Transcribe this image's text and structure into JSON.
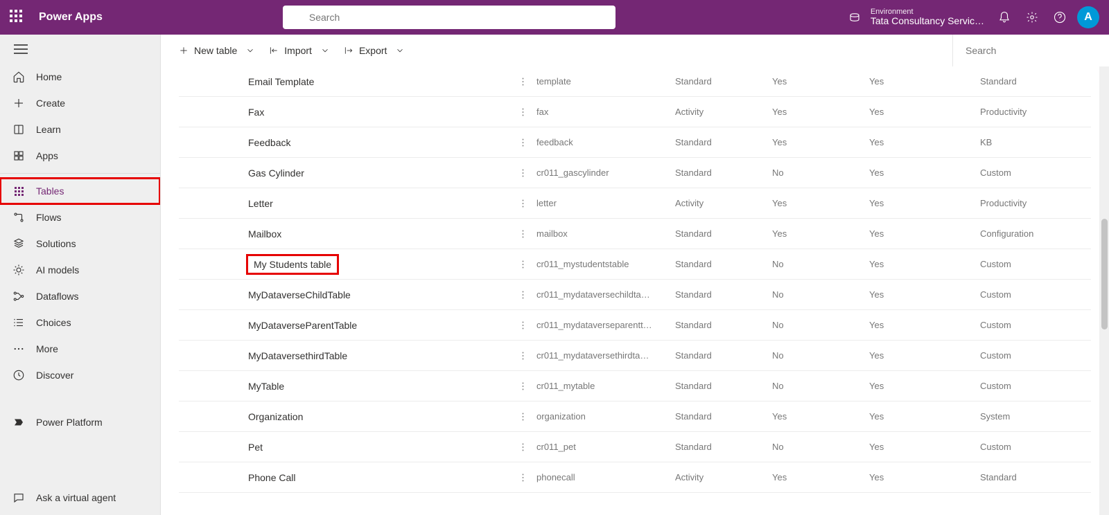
{
  "header": {
    "brand": "Power Apps",
    "search_placeholder": "Search",
    "env_label": "Environment",
    "env_name": "Tata Consultancy Servic…",
    "avatar": "A"
  },
  "sidebar": {
    "items": [
      {
        "id": "home",
        "label": "Home"
      },
      {
        "id": "create",
        "label": "Create"
      },
      {
        "id": "learn",
        "label": "Learn"
      },
      {
        "id": "apps",
        "label": "Apps"
      },
      {
        "id": "tables",
        "label": "Tables"
      },
      {
        "id": "flows",
        "label": "Flows"
      },
      {
        "id": "solutions",
        "label": "Solutions"
      },
      {
        "id": "ai-models",
        "label": "AI models"
      },
      {
        "id": "dataflows",
        "label": "Dataflows"
      },
      {
        "id": "choices",
        "label": "Choices"
      },
      {
        "id": "more",
        "label": "More"
      },
      {
        "id": "discover",
        "label": "Discover"
      }
    ],
    "bottom": [
      {
        "id": "power-platform",
        "label": "Power Platform"
      }
    ],
    "ask": {
      "label": "Ask a virtual agent"
    }
  },
  "cmdbar": {
    "new_table": "New table",
    "import": "Import",
    "export": "Export",
    "search_placeholder": "Search"
  },
  "table": {
    "rows": [
      {
        "name": "Email Template",
        "schema": "template",
        "type": "Standard",
        "managed": "Yes",
        "customizable": "Yes",
        "tag": "Standard"
      },
      {
        "name": "Fax",
        "schema": "fax",
        "type": "Activity",
        "managed": "Yes",
        "customizable": "Yes",
        "tag": "Productivity"
      },
      {
        "name": "Feedback",
        "schema": "feedback",
        "type": "Standard",
        "managed": "Yes",
        "customizable": "Yes",
        "tag": "KB"
      },
      {
        "name": "Gas Cylinder",
        "schema": "cr011_gascylinder",
        "type": "Standard",
        "managed": "No",
        "customizable": "Yes",
        "tag": "Custom"
      },
      {
        "name": "Letter",
        "schema": "letter",
        "type": "Activity",
        "managed": "Yes",
        "customizable": "Yes",
        "tag": "Productivity"
      },
      {
        "name": "Mailbox",
        "schema": "mailbox",
        "type": "Standard",
        "managed": "Yes",
        "customizable": "Yes",
        "tag": "Configuration"
      },
      {
        "name": "My Students table",
        "schema": "cr011_mystudentstable",
        "type": "Standard",
        "managed": "No",
        "customizable": "Yes",
        "tag": "Custom",
        "highlight": true
      },
      {
        "name": "MyDataverseChildTable",
        "schema": "cr011_mydataversechildta…",
        "type": "Standard",
        "managed": "No",
        "customizable": "Yes",
        "tag": "Custom"
      },
      {
        "name": "MyDataverseParentTable",
        "schema": "cr011_mydataverseparentt…",
        "type": "Standard",
        "managed": "No",
        "customizable": "Yes",
        "tag": "Custom"
      },
      {
        "name": "MyDataversethirdTable",
        "schema": "cr011_mydataversethirdta…",
        "type": "Standard",
        "managed": "No",
        "customizable": "Yes",
        "tag": "Custom"
      },
      {
        "name": "MyTable",
        "schema": "cr011_mytable",
        "type": "Standard",
        "managed": "No",
        "customizable": "Yes",
        "tag": "Custom"
      },
      {
        "name": "Organization",
        "schema": "organization",
        "type": "Standard",
        "managed": "Yes",
        "customizable": "Yes",
        "tag": "System"
      },
      {
        "name": "Pet",
        "schema": "cr011_pet",
        "type": "Standard",
        "managed": "No",
        "customizable": "Yes",
        "tag": "Custom"
      },
      {
        "name": "Phone Call",
        "schema": "phonecall",
        "type": "Activity",
        "managed": "Yes",
        "customizable": "Yes",
        "tag": "Standard"
      }
    ]
  }
}
